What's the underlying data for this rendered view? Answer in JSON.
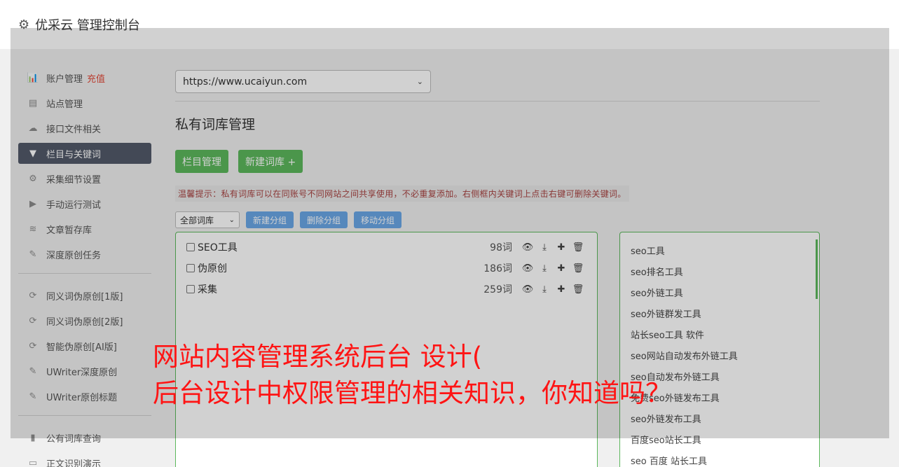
{
  "header": {
    "title": "优采云 管理控制台"
  },
  "sidebar": {
    "group1": [
      {
        "label": "账户管理",
        "badge": "充值",
        "icon": "bar-chart-icon",
        "glyph": "📊"
      },
      {
        "label": "站点管理",
        "icon": "server-icon",
        "glyph": "▤"
      },
      {
        "label": "接口文件相关",
        "icon": "cloud-upload-icon",
        "glyph": "☁"
      },
      {
        "label": "栏目与关键词",
        "icon": "filter-icon",
        "glyph": "▼",
        "active": true
      },
      {
        "label": "采集细节设置",
        "icon": "cogs-icon",
        "glyph": "⚙"
      },
      {
        "label": "手动运行测试",
        "icon": "play-circle-icon",
        "glyph": "▶"
      },
      {
        "label": "文章暂存库",
        "icon": "database-icon",
        "glyph": "≋"
      },
      {
        "label": "深度原创任务",
        "icon": "edit-icon",
        "glyph": "✎"
      }
    ],
    "group2": [
      {
        "label": "同义词伪原创[1版]",
        "icon": "refresh-icon",
        "glyph": "⟳"
      },
      {
        "label": "同义词伪原创[2版]",
        "icon": "refresh-icon",
        "glyph": "⟳"
      },
      {
        "label": "智能伪原创[AI版]",
        "icon": "refresh-icon",
        "glyph": "⟳"
      },
      {
        "label": "UWriter深度原创",
        "icon": "edit-icon",
        "glyph": "✎"
      },
      {
        "label": "UWriter原创标题",
        "icon": "edit-icon",
        "glyph": "✎"
      }
    ],
    "group3": [
      {
        "label": "公有词库查询",
        "icon": "book-icon",
        "glyph": "▮"
      },
      {
        "label": "正文识别演示",
        "icon": "desktop-icon",
        "glyph": "▭"
      }
    ]
  },
  "main": {
    "site_select": "https://www.ucaiyun.com",
    "page_title": "私有词库管理",
    "buttons": {
      "column_manage": "栏目管理",
      "new_library": "新建词库 +"
    },
    "tip": "温馨提示：私有词库可以在同账号不同网站之间共享使用，不必重复添加。右侧框内关键词上点击右键可删除关键词。",
    "group_select": "全部词库",
    "group_buttons": {
      "new_group": "新建分组",
      "delete_group": "删除分组",
      "move_group": "移动分组"
    },
    "libraries": [
      {
        "name": "SEO工具",
        "count": "98词"
      },
      {
        "name": "伪原创",
        "count": "186词"
      },
      {
        "name": "采集",
        "count": "259词"
      }
    ],
    "keywords": [
      "seo工具",
      "seo排名工具",
      "seo外链工具",
      "seo外链群发工具",
      "站长seo工具 软件",
      "seo网站自动发布外链工具",
      "seo自动发布外链工具",
      "免费seo外链发布工具",
      "seo外链发布工具",
      "百度seo站长工具",
      "seo 百度 站长工具"
    ]
  },
  "overlay_text": {
    "line1": "网站内容管理系统后台 设计(",
    "line2": "后台设计中权限管理的相关知识，你知道吗？"
  }
}
